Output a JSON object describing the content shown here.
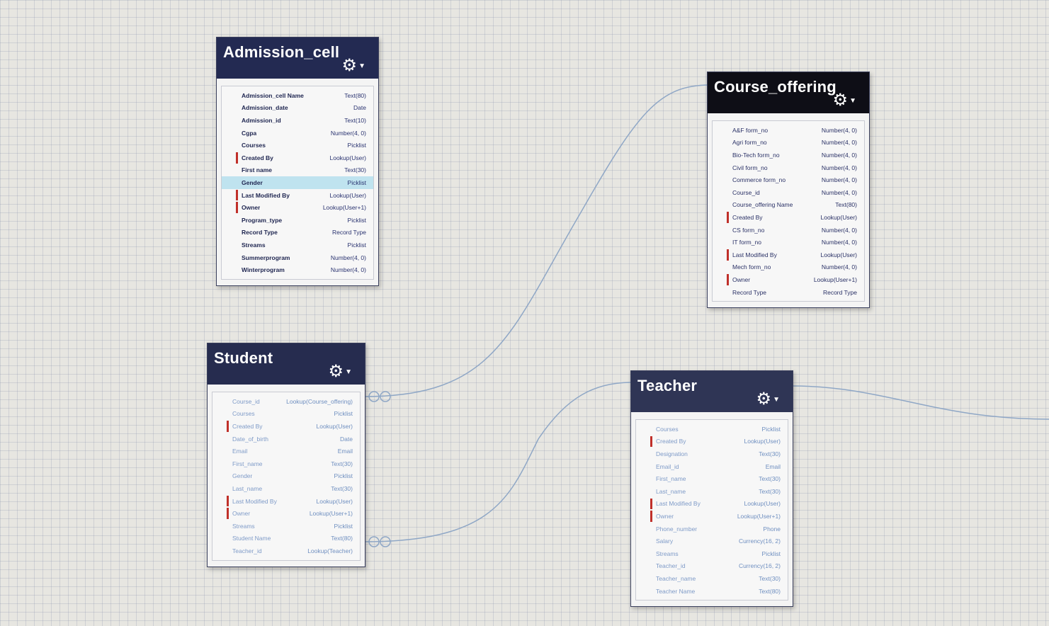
{
  "entities": [
    {
      "id": "admission_cell",
      "title": "Admission_cell",
      "header_color": "#232a52",
      "text_style": "dark",
      "fields": [
        {
          "name": "Admission_cell Name",
          "type": "Text(80)",
          "required": false
        },
        {
          "name": "Admission_date",
          "type": "Date",
          "required": false
        },
        {
          "name": "Admission_id",
          "type": "Text(10)",
          "required": false
        },
        {
          "name": "Cgpa",
          "type": "Number(4, 0)",
          "required": false
        },
        {
          "name": "Courses",
          "type": "Picklist",
          "required": false
        },
        {
          "name": "Created By",
          "type": "Lookup(User)",
          "required": true
        },
        {
          "name": "First name",
          "type": "Text(30)",
          "required": false
        },
        {
          "name": "Gender",
          "type": "Picklist",
          "required": false,
          "highlighted": true
        },
        {
          "name": "Last Modified By",
          "type": "Lookup(User)",
          "required": true
        },
        {
          "name": "Owner",
          "type": "Lookup(User+1)",
          "required": true
        },
        {
          "name": "Program_type",
          "type": "Picklist",
          "required": false
        },
        {
          "name": "Record Type",
          "type": "Record Type",
          "required": false
        },
        {
          "name": "Streams",
          "type": "Picklist",
          "required": false
        },
        {
          "name": "Summerprogram",
          "type": "Number(4, 0)",
          "required": false
        },
        {
          "name": "Winterprogram",
          "type": "Number(4, 0)",
          "required": false
        }
      ]
    },
    {
      "id": "course_offering",
      "title": "Course_offering",
      "header_color": "#0e0e16",
      "text_style": "mid",
      "fields": [
        {
          "name": "A&F form_no",
          "type": "Number(4, 0)",
          "required": false
        },
        {
          "name": "Agri form_no",
          "type": "Number(4, 0)",
          "required": false
        },
        {
          "name": "Bio-Tech form_no",
          "type": "Number(4, 0)",
          "required": false
        },
        {
          "name": "Civil form_no",
          "type": "Number(4, 0)",
          "required": false
        },
        {
          "name": "Commerce form_no",
          "type": "Number(4, 0)",
          "required": false
        },
        {
          "name": "Course_id",
          "type": "Number(4, 0)",
          "required": false
        },
        {
          "name": "Course_offering Name",
          "type": "Text(80)",
          "required": false
        },
        {
          "name": "Created By",
          "type": "Lookup(User)",
          "required": true
        },
        {
          "name": "CS form_no",
          "type": "Number(4, 0)",
          "required": false
        },
        {
          "name": "IT form_no",
          "type": "Number(4, 0)",
          "required": false
        },
        {
          "name": "Last Modified By",
          "type": "Lookup(User)",
          "required": true
        },
        {
          "name": "Mech form_no",
          "type": "Number(4, 0)",
          "required": false
        },
        {
          "name": "Owner",
          "type": "Lookup(User+1)",
          "required": true
        },
        {
          "name": "Record Type",
          "type": "Record Type",
          "required": false
        }
      ]
    },
    {
      "id": "student",
      "title": "Student",
      "header_color": "#262c4f",
      "text_style": "faded",
      "fields": [
        {
          "name": "Course_id",
          "type": "Lookup(Course_offering)",
          "required": false
        },
        {
          "name": "Courses",
          "type": "Picklist",
          "required": false
        },
        {
          "name": "Created By",
          "type": "Lookup(User)",
          "required": true
        },
        {
          "name": "Date_of_birth",
          "type": "Date",
          "required": false
        },
        {
          "name": "Email",
          "type": "Email",
          "required": false
        },
        {
          "name": "First_name",
          "type": "Text(30)",
          "required": false
        },
        {
          "name": "Gender",
          "type": "Picklist",
          "required": false
        },
        {
          "name": "Last_name",
          "type": "Text(30)",
          "required": false
        },
        {
          "name": "Last Modified By",
          "type": "Lookup(User)",
          "required": true
        },
        {
          "name": "Owner",
          "type": "Lookup(User+1)",
          "required": true
        },
        {
          "name": "Streams",
          "type": "Picklist",
          "required": false
        },
        {
          "name": "Student Name",
          "type": "Text(80)",
          "required": false
        },
        {
          "name": "Teacher_id",
          "type": "Lookup(Teacher)",
          "required": false
        }
      ]
    },
    {
      "id": "teacher",
      "title": "Teacher",
      "header_color": "#2f3555",
      "text_style": "faded",
      "fields": [
        {
          "name": "Courses",
          "type": "Picklist",
          "required": false
        },
        {
          "name": "Created By",
          "type": "Lookup(User)",
          "required": true
        },
        {
          "name": "Designation",
          "type": "Text(30)",
          "required": false
        },
        {
          "name": "Email_id",
          "type": "Email",
          "required": false
        },
        {
          "name": "First_name",
          "type": "Text(30)",
          "required": false
        },
        {
          "name": "Last_name",
          "type": "Text(30)",
          "required": false
        },
        {
          "name": "Last Modified By",
          "type": "Lookup(User)",
          "required": true
        },
        {
          "name": "Owner",
          "type": "Lookup(User+1)",
          "required": true
        },
        {
          "name": "Phone_number",
          "type": "Phone",
          "required": false
        },
        {
          "name": "Salary",
          "type": "Currency(16, 2)",
          "required": false
        },
        {
          "name": "Streams",
          "type": "Picklist",
          "required": false
        },
        {
          "name": "Teacher_id",
          "type": "Currency(16, 2)",
          "required": false
        },
        {
          "name": "Teacher_name",
          "type": "Text(30)",
          "required": false
        },
        {
          "name": "Teacher Name",
          "type": "Text(80)",
          "required": false
        }
      ]
    }
  ],
  "icons": {
    "gear": "gear-icon",
    "caret": "chevron-down-icon"
  },
  "colors": {
    "link_line": "#8fa7c6",
    "required_marker": "#c0302a",
    "highlight_row": "#bfe3ef"
  }
}
